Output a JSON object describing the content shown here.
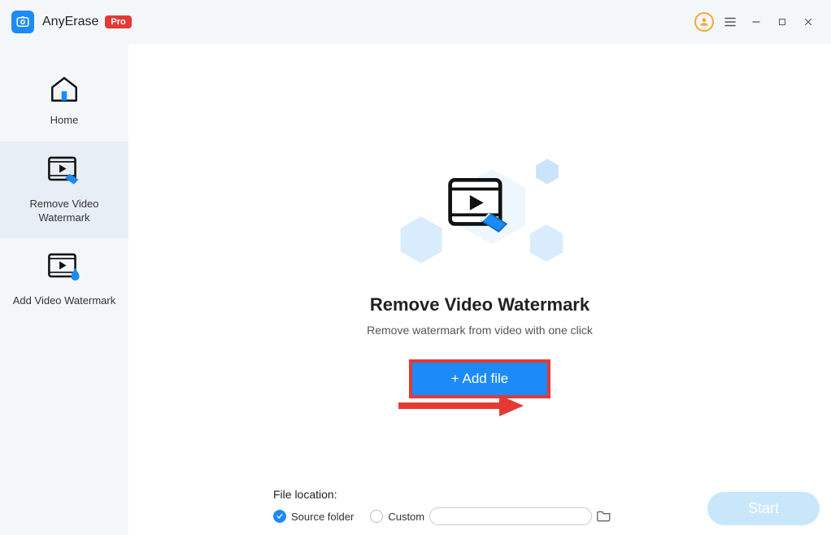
{
  "titlebar": {
    "app_name": "AnyErase",
    "pro_badge": "Pro"
  },
  "sidebar": {
    "items": [
      {
        "label": "Home"
      },
      {
        "label": "Remove Video Watermark"
      },
      {
        "label": "Add Video Watermark"
      }
    ]
  },
  "main": {
    "title": "Remove Video Watermark",
    "subtitle": "Remove watermark from video with one click",
    "add_file_label": "+ Add file"
  },
  "footer": {
    "file_location_label": "File location:",
    "source_folder_label": "Source folder",
    "custom_label": "Custom",
    "custom_path": "",
    "start_label": "Start"
  }
}
